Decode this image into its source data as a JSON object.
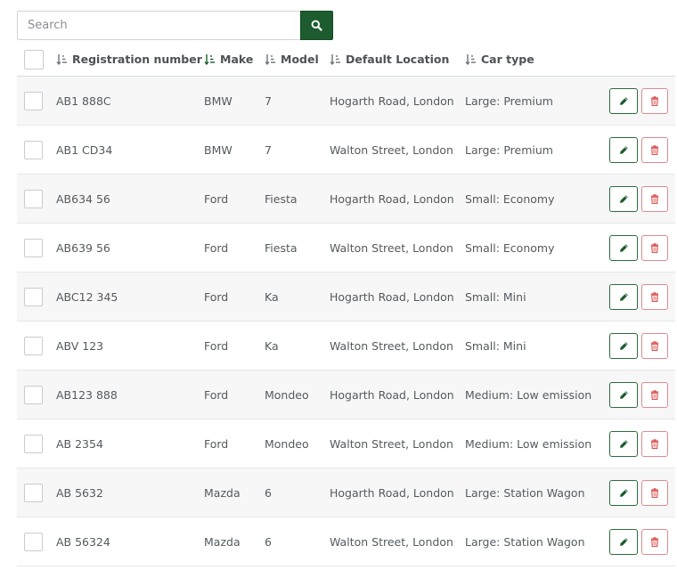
{
  "search": {
    "placeholder": "Search",
    "value": ""
  },
  "colors": {
    "accent": "#1d5c2e",
    "edit_border": "#2e6b3c",
    "delete_border": "#e08a8f",
    "delete_icon": "#d9534f"
  },
  "columns": {
    "registration": "Registration number",
    "make": "Make",
    "model": "Model",
    "location": "Default Location",
    "type": "Car type"
  },
  "rows": [
    {
      "registration": "AB1 888C",
      "make": "BMW",
      "model": "7",
      "location": "Hogarth Road, London",
      "type": "Large: Premium"
    },
    {
      "registration": "AB1 CD34",
      "make": "BMW",
      "model": "7",
      "location": "Walton Street, London",
      "type": "Large: Premium"
    },
    {
      "registration": "AB634 56",
      "make": "Ford",
      "model": "Fiesta",
      "location": "Hogarth Road, London",
      "type": "Small: Economy"
    },
    {
      "registration": "AB639 56",
      "make": "Ford",
      "model": "Fiesta",
      "location": "Walton Street, London",
      "type": "Small: Economy"
    },
    {
      "registration": "ABC12 345",
      "make": "Ford",
      "model": "Ka",
      "location": "Hogarth Road, London",
      "type": "Small: Mini"
    },
    {
      "registration": "ABV 123",
      "make": "Ford",
      "model": "Ka",
      "location": "Walton Street, London",
      "type": "Small: Mini"
    },
    {
      "registration": "AB123 888",
      "make": "Ford",
      "model": "Mondeo",
      "location": "Hogarth Road, London",
      "type": "Medium: Low emission"
    },
    {
      "registration": "AB 2354",
      "make": "Ford",
      "model": "Mondeo",
      "location": "Walton Street, London",
      "type": "Medium: Low emission"
    },
    {
      "registration": "AB 5632",
      "make": "Mazda",
      "model": "6",
      "location": "Hogarth Road, London",
      "type": "Large: Station Wagon"
    },
    {
      "registration": "AB 56324",
      "make": "Mazda",
      "model": "6",
      "location": "Walton Street, London",
      "type": "Large: Station Wagon"
    }
  ]
}
